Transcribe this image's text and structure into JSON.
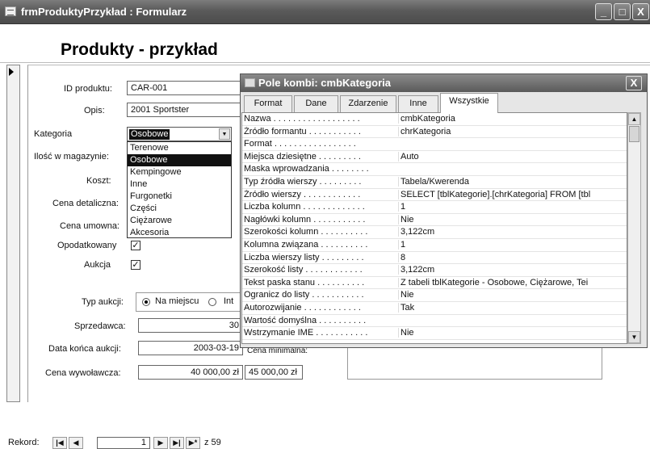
{
  "window": {
    "title": "frmProduktyPrzykład : Formularz",
    "minimize": "_",
    "maximize": "□",
    "close": "X"
  },
  "form": {
    "title": "Produkty - przykład",
    "fields": {
      "id_label": "ID produktu:",
      "id_value": "CAR-001",
      "opis_label": "Opis:",
      "opis_value": "2001 Sportster",
      "kategoria_label": "Kategoria",
      "kategoria_value": "Osobowe",
      "ilosc_label": "Ilość w magazynie:",
      "koszt_label": "Koszt:",
      "cena_det_label": "Cena detaliczna:",
      "cena_um_label": "Cena umowna:",
      "opodatkowany_label": "Opodatkowany",
      "aukcja_label": "Aukcja",
      "typ_aukcji_label": "Typ aukcji:",
      "typ_opt1": "Na miejscu",
      "typ_opt2": "Int",
      "sprzedawca_label": "Sprzedawca:",
      "sprzedawca_value": "30",
      "data_label": "Data końca aukcji:",
      "data_value": "2003-03-19",
      "cena_min_label": "Cena minimalna:",
      "cena_wyw_label": "Cena wywoławcza:",
      "cena_wyw_value": "40 000,00 zł",
      "cena_min_value": "45 000,00 zł"
    },
    "checkbox_checked": "✓",
    "dropdown_items": [
      "Terenowe",
      "Osobowe",
      "Kempingowe",
      "Inne",
      "Furgonetki",
      "Części",
      "Ciężarowe",
      "Akcesoria"
    ],
    "dropdown_selected": "Osobowe"
  },
  "nav": {
    "label": "Rekord:",
    "first": "|◀",
    "prev": "◀",
    "record": "1",
    "next": "▶",
    "last": "▶|",
    "new": "▶*",
    "count": "z 59"
  },
  "property_sheet": {
    "title": "Pole kombi: cmbKategoria",
    "close": "X",
    "tabs": [
      "Format",
      "Dane",
      "Zdarzenie",
      "Inne",
      "Wszystkie"
    ],
    "active_tab": "Wszystkie",
    "rows": [
      [
        "Nazwa . . . . . . . . . . . . . . . . . .",
        "cmbKategoria"
      ],
      [
        "Źródło formantu . . . . . . . . . . .",
        "chrKategoria"
      ],
      [
        "Format . . . . . . . . . . . . . . . . .",
        ""
      ],
      [
        "Miejsca dziesiętne . . . . . . . . .",
        "Auto"
      ],
      [
        "Maska wprowadzania . . . . . . . .",
        ""
      ],
      [
        "Typ źródła wierszy . . . . . . . . .",
        "Tabela/Kwerenda"
      ],
      [
        "Źródło wierszy . . . . . . . . . . . .",
        "SELECT [tblKategorie].[chrKategoria] FROM [tbl"
      ],
      [
        "Liczba kolumn . . . . . . . . . . . . .",
        "1"
      ],
      [
        "Nagłówki kolumn . . . . . . . . . . .",
        "Nie"
      ],
      [
        "Szerokości kolumn . . . . . . . . . .",
        "3,122cm"
      ],
      [
        "Kolumna związana . . . . . . . . . .",
        "1"
      ],
      [
        "Liczba wierszy listy . . . . . . . . .",
        "8"
      ],
      [
        "Szerokość listy . . . . . . . . . . . .",
        "3,122cm"
      ],
      [
        "Tekst paska stanu . . . . . . . . . .",
        "Z tabeli tblKategorie - Osobowe, Ciężarowe, Tei"
      ],
      [
        "Ogranicz do listy . . . . . . . . . . .",
        "Nie"
      ],
      [
        "Autorozwijanie . . . . . . . . . . . .",
        "Tak"
      ],
      [
        "Wartość domyślna . . . . . . . . . .",
        ""
      ],
      [
        "Wstrzymanie IME . . . . . . . . . . .",
        "Nie"
      ]
    ]
  },
  "colors": {
    "titlebar": "#5a5a5a",
    "selection": "#111111",
    "sheet_bg": "#e6e6e6"
  }
}
